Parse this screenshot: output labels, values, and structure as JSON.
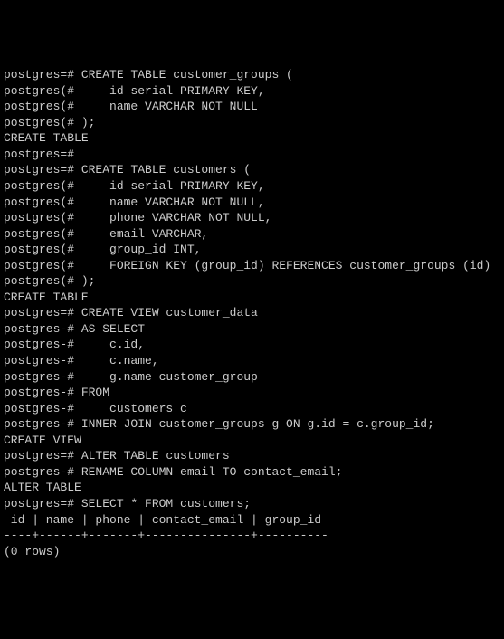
{
  "terminal": {
    "lines": [
      "postgres=# CREATE TABLE customer_groups (",
      "postgres(#     id serial PRIMARY KEY,",
      "postgres(#     name VARCHAR NOT NULL",
      "postgres(# );",
      "CREATE TABLE",
      "postgres=#",
      "postgres=# CREATE TABLE customers (",
      "postgres(#     id serial PRIMARY KEY,",
      "postgres(#     name VARCHAR NOT NULL,",
      "postgres(#     phone VARCHAR NOT NULL,",
      "postgres(#     email VARCHAR,",
      "postgres(#     group_id INT,",
      "postgres(#     FOREIGN KEY (group_id) REFERENCES customer_groups (id)",
      "postgres(# );",
      "CREATE TABLE",
      "postgres=# CREATE VIEW customer_data",
      "postgres-# AS SELECT",
      "postgres-#     c.id,",
      "postgres-#     c.name,",
      "postgres-#     g.name customer_group",
      "postgres-# FROM",
      "postgres-#     customers c",
      "postgres-# INNER JOIN customer_groups g ON g.id = c.group_id;",
      "CREATE VIEW",
      "postgres=# ALTER TABLE customers",
      "postgres-# RENAME COLUMN email TO contact_email;",
      "ALTER TABLE",
      "postgres=# SELECT * FROM customers;",
      " id | name | phone | contact_email | group_id",
      "----+------+-------+---------------+----------",
      "(0 rows)"
    ]
  }
}
